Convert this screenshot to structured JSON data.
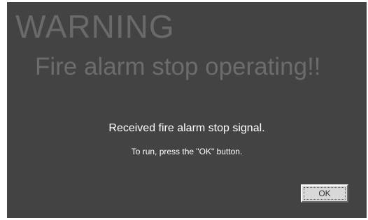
{
  "dialog": {
    "title": "WARNING",
    "subtitle": "Fire alarm stop operating!!",
    "message": "Received fire alarm stop signal.",
    "instruction": "To run, press the \"OK\" button.",
    "ok_label": "OK"
  },
  "colors": {
    "background": "#434343",
    "title_text": "#6a6a6a",
    "message_text": "#ffffff",
    "button_face": "#d8d8d8"
  }
}
